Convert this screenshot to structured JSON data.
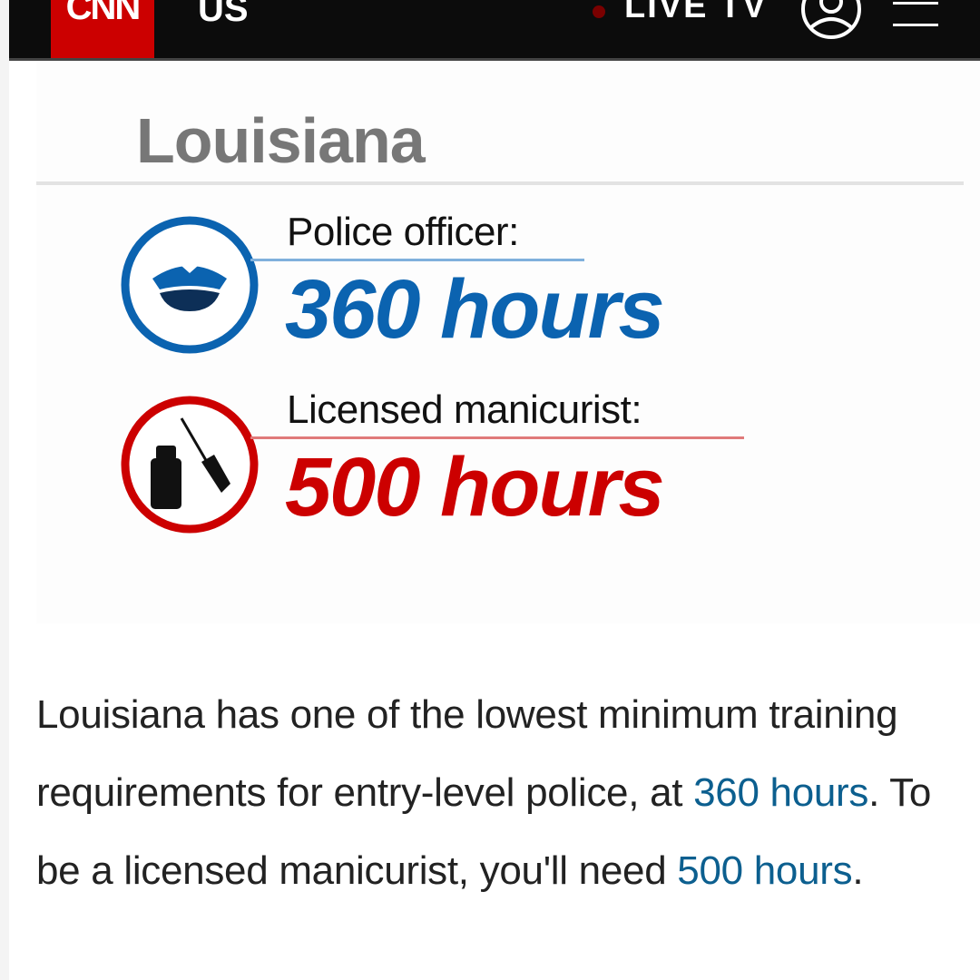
{
  "header": {
    "logo_text": "CNN",
    "section": "US",
    "live_label": "LIVE TV",
    "colors": {
      "bar": "#0c0c0c",
      "logo_bg": "#cc0000"
    },
    "icons": [
      "user-icon",
      "menu-icon"
    ]
  },
  "graphic": {
    "title": "Louisiana",
    "stats": [
      {
        "label": "Police officer:",
        "value": "360 hours",
        "color": "#0b63b0",
        "icon": "police-cap-icon"
      },
      {
        "label": "Licensed manicurist:",
        "value": "500 hours",
        "color": "#cc0000",
        "icon": "nail-polish-icon"
      }
    ]
  },
  "article": {
    "text_1": "Louisiana has one of the lowest minimum training requirements for entry-level police, at ",
    "link_1": "360 hours",
    "text_2": ". To be a licensed manicurist, you'll need ",
    "link_2": "500 hours",
    "text_3": ".",
    "link_color": "#0c5f8f"
  }
}
